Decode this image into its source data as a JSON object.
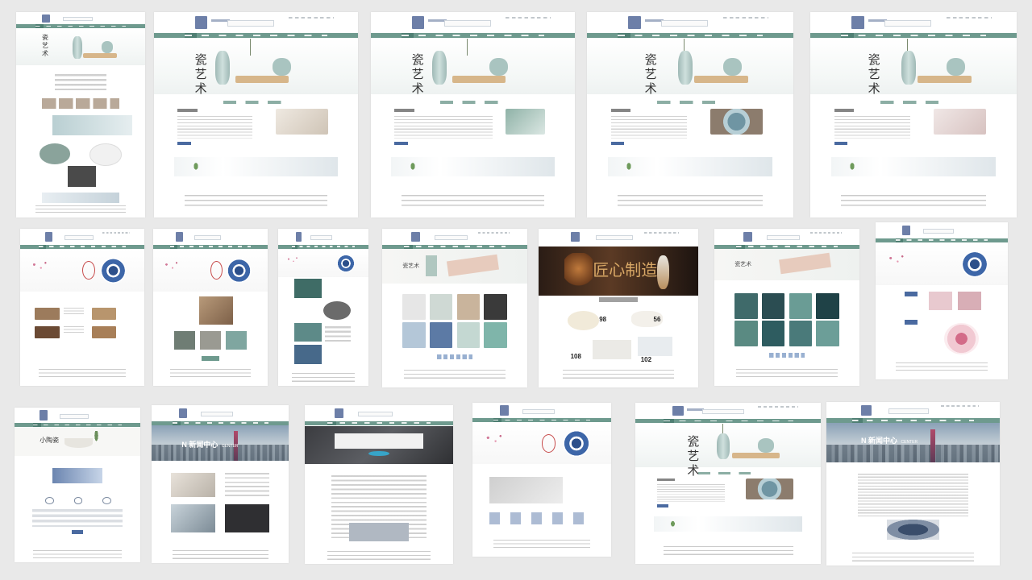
{
  "pages": [
    {
      "id": "home-long",
      "banner": {
        "title_chars": [
          "瓷",
          "艺术"
        ]
      }
    },
    {
      "id": "product-1",
      "banner": {
        "title_chars": [
          "瓷",
          "艺",
          "术"
        ]
      }
    },
    {
      "id": "product-2",
      "banner": {
        "title_chars": [
          "瓷",
          "艺",
          "术"
        ]
      }
    },
    {
      "id": "product-3",
      "banner": {
        "title_chars": [
          "瓷",
          "艺",
          "术"
        ]
      }
    },
    {
      "id": "product-4",
      "banner": {
        "title_chars": [
          "瓷",
          "艺",
          "术"
        ]
      }
    },
    {
      "id": "plum-cases",
      "banner": {}
    },
    {
      "id": "plum-list",
      "banner": {}
    },
    {
      "id": "plum-gallery",
      "banner": {}
    },
    {
      "id": "dish-grid",
      "banner": {
        "title": "瓷艺术"
      }
    },
    {
      "id": "craft-sale",
      "banner": {
        "title": "匠心制造"
      },
      "prices": [
        "98",
        "56",
        "108",
        "102"
      ]
    },
    {
      "id": "green-grid",
      "banner": {
        "title": "瓷艺术"
      }
    },
    {
      "id": "pink-products",
      "banner": {}
    },
    {
      "id": "contact",
      "banner": {
        "title": "小陶瓷"
      }
    },
    {
      "id": "news-center",
      "banner": {
        "title": "N 新闻中心",
        "subtitle": "CENTER"
      }
    },
    {
      "id": "notebook-article",
      "banner": {}
    },
    {
      "id": "about",
      "banner": {}
    },
    {
      "id": "product-5",
      "banner": {
        "title_chars": [
          "瓷",
          "艺",
          "术"
        ]
      }
    },
    {
      "id": "news-article",
      "banner": {
        "title": "N 新闻中心",
        "subtitle": "CENTER"
      }
    }
  ],
  "colors": {
    "background": "#e9e9e9",
    "nav": "#6e9a8e",
    "nav_active": "#4f7f73",
    "accent_blue": "#4a6aa0"
  }
}
